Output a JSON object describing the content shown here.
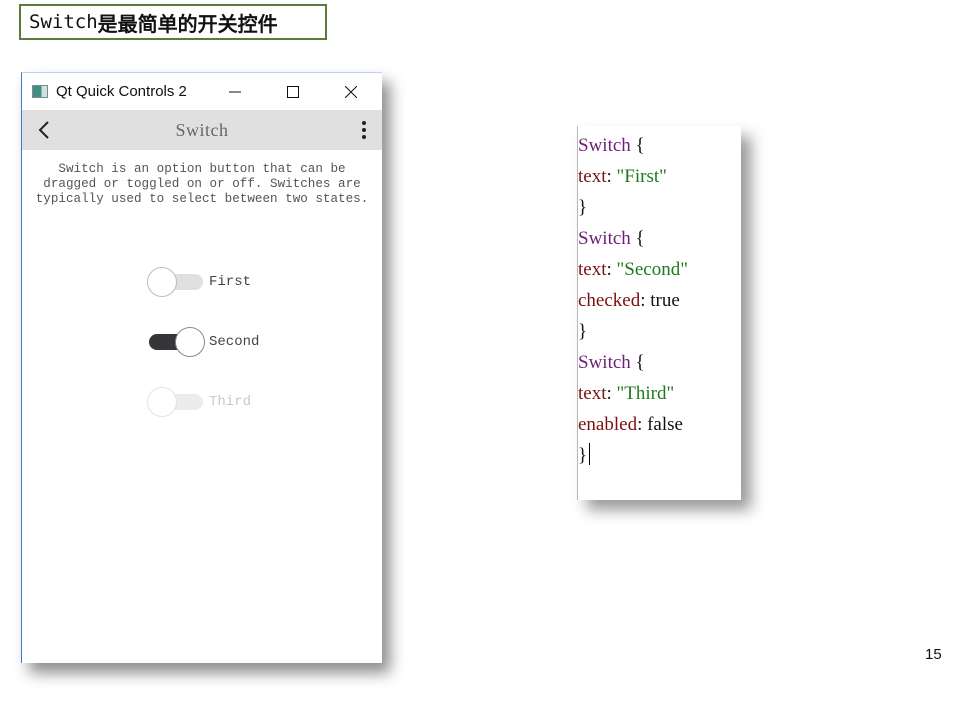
{
  "slide": {
    "title_latin": "Switch",
    "title_cn": "是最简单的开关控件",
    "page_number": "15"
  },
  "window": {
    "title": "Qt Quick Controls 2",
    "icons": {
      "app": "qt-app-icon",
      "minimize": "minimize-icon",
      "maximize": "maximize-icon",
      "close": "close-icon"
    },
    "toolbar": {
      "title": "Switch",
      "back_icon": "chevron-left-icon",
      "menu_icon": "more-vertical-icon"
    },
    "description": "Switch is an option button that can be dragged or toggled on or off. Switches are typically used to select between two states.",
    "switches": [
      {
        "label": "First",
        "checked": false,
        "enabled": true
      },
      {
        "label": "Second",
        "checked": true,
        "enabled": true
      },
      {
        "label": "Third",
        "checked": false,
        "enabled": false
      }
    ]
  },
  "code": {
    "lines": [
      [
        {
          "t": "kw",
          "v": "Switch"
        },
        {
          "t": "plain",
          "v": " {"
        }
      ],
      [
        {
          "t": "prop",
          "v": "text"
        },
        {
          "t": "plain",
          "v": ": "
        },
        {
          "t": "str",
          "v": "\"First\""
        }
      ],
      [
        {
          "t": "plain",
          "v": "}"
        }
      ],
      [
        {
          "t": "kw",
          "v": "Switch"
        },
        {
          "t": "plain",
          "v": " {"
        }
      ],
      [
        {
          "t": "prop",
          "v": "text"
        },
        {
          "t": "plain",
          "v": ": "
        },
        {
          "t": "str",
          "v": "\"Second\""
        }
      ],
      [
        {
          "t": "prop",
          "v": "checked"
        },
        {
          "t": "plain",
          "v": ": true"
        }
      ],
      [
        {
          "t": "plain",
          "v": "}"
        }
      ],
      [
        {
          "t": "kw",
          "v": "Switch"
        },
        {
          "t": "plain",
          "v": " {"
        }
      ],
      [
        {
          "t": "prop",
          "v": "text"
        },
        {
          "t": "plain",
          "v": ": "
        },
        {
          "t": "str",
          "v": "\"Third\""
        }
      ],
      [
        {
          "t": "prop",
          "v": "enabled"
        },
        {
          "t": "plain",
          "v": ": false"
        }
      ],
      [
        {
          "t": "plain",
          "v": "}"
        }
      ]
    ]
  },
  "colors": {
    "title_border": "#5b7b3a",
    "toolbar_bg": "#e0e0e0",
    "switch_on_track": "#353637",
    "code_keyword": "#6d1f77",
    "code_property": "#7a1010",
    "code_string": "#1e7a1e"
  }
}
